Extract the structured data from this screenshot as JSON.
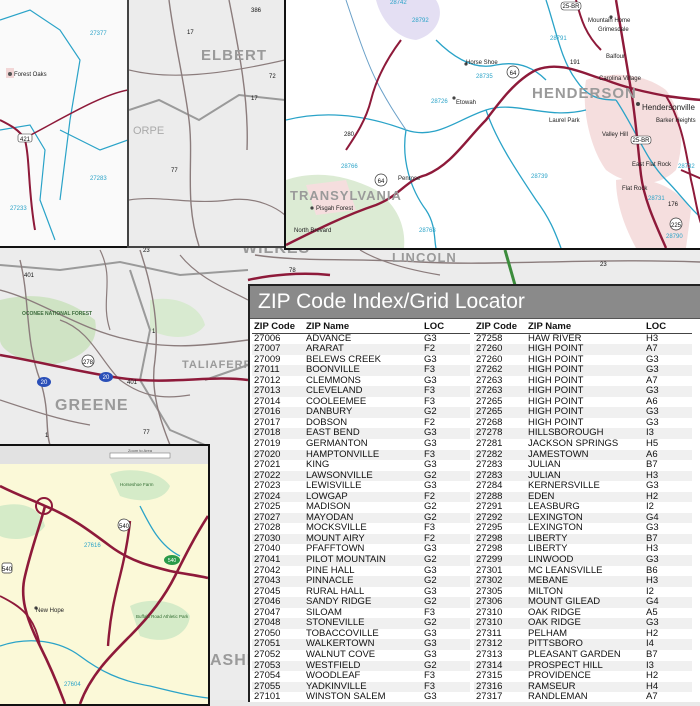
{
  "index": {
    "title": "ZIP Code Index/Grid Locator",
    "headers": [
      "ZIP Code",
      "ZIP Name",
      "LOC"
    ],
    "left_rows": [
      [
        "27006",
        "ADVANCE",
        "G3"
      ],
      [
        "27007",
        "ARARAT",
        "F2"
      ],
      [
        "27009",
        "BELEWS CREEK",
        "G3"
      ],
      [
        "27011",
        "BOONVILLE",
        "F3"
      ],
      [
        "27012",
        "CLEMMONS",
        "G3"
      ],
      [
        "27013",
        "CLEVELAND",
        "F3"
      ],
      [
        "27014",
        "COOLEEMEE",
        "F3"
      ],
      [
        "27016",
        "DANBURY",
        "G2"
      ],
      [
        "27017",
        "DOBSON",
        "F2"
      ],
      [
        "27018",
        "EAST BEND",
        "G3"
      ],
      [
        "27019",
        "GERMANTON",
        "G3"
      ],
      [
        "27020",
        "HAMPTONVILLE",
        "F3"
      ],
      [
        "27021",
        "KING",
        "G3"
      ],
      [
        "27022",
        "LAWSONVILLE",
        "G2"
      ],
      [
        "27023",
        "LEWISVILLE",
        "G3"
      ],
      [
        "27024",
        "LOWGAP",
        "F2"
      ],
      [
        "27025",
        "MADISON",
        "G2"
      ],
      [
        "27027",
        "MAYODAN",
        "G2"
      ],
      [
        "27028",
        "MOCKSVILLE",
        "F3"
      ],
      [
        "27030",
        "MOUNT AIRY",
        "F2"
      ],
      [
        "27040",
        "PFAFFTOWN",
        "G3"
      ],
      [
        "27041",
        "PILOT MOUNTAIN",
        "G2"
      ],
      [
        "27042",
        "PINE HALL",
        "G3"
      ],
      [
        "27043",
        "PINNACLE",
        "G2"
      ],
      [
        "27045",
        "RURAL HALL",
        "G3"
      ],
      [
        "27046",
        "SANDY RIDGE",
        "G2"
      ],
      [
        "27047",
        "SILOAM",
        "F3"
      ],
      [
        "27048",
        "STONEVILLE",
        "G2"
      ],
      [
        "27050",
        "TOBACCOVILLE",
        "G3"
      ],
      [
        "27051",
        "WALKERTOWN",
        "G3"
      ],
      [
        "27052",
        "WALNUT COVE",
        "G3"
      ],
      [
        "27053",
        "WESTFIELD",
        "G2"
      ],
      [
        "27054",
        "WOODLEAF",
        "F3"
      ],
      [
        "27055",
        "YADKINVILLE",
        "F3"
      ],
      [
        "27101",
        "WINSTON SALEM",
        "G3"
      ]
    ],
    "right_rows": [
      [
        "27258",
        "HAW RIVER",
        "H3"
      ],
      [
        "27260",
        "HIGH POINT",
        "A7"
      ],
      [
        "27260",
        "HIGH POINT",
        "G3"
      ],
      [
        "27262",
        "HIGH POINT",
        "G3"
      ],
      [
        "27263",
        "HIGH POINT",
        "A7"
      ],
      [
        "27263",
        "HIGH POINT",
        "G3"
      ],
      [
        "27265",
        "HIGH POINT",
        "A6"
      ],
      [
        "27265",
        "HIGH POINT",
        "G3"
      ],
      [
        "27268",
        "HIGH POINT",
        "G3"
      ],
      [
        "27278",
        "HILLSBOROUGH",
        "I3"
      ],
      [
        "27281",
        "JACKSON SPRINGS",
        "H5"
      ],
      [
        "27282",
        "JAMESTOWN",
        "A6"
      ],
      [
        "27283",
        "JULIAN",
        "B7"
      ],
      [
        "27283",
        "JULIAN",
        "H3"
      ],
      [
        "27284",
        "KERNERSVILLE",
        "G3"
      ],
      [
        "27288",
        "EDEN",
        "H2"
      ],
      [
        "27291",
        "LEASBURG",
        "I2"
      ],
      [
        "27292",
        "LEXINGTON",
        "G4"
      ],
      [
        "27295",
        "LEXINGTON",
        "G3"
      ],
      [
        "27298",
        "LIBERTY",
        "B7"
      ],
      [
        "27298",
        "LIBERTY",
        "H3"
      ],
      [
        "27299",
        "LINWOOD",
        "G3"
      ],
      [
        "27301",
        "MC LEANSVILLE",
        "B6"
      ],
      [
        "27302",
        "MEBANE",
        "H3"
      ],
      [
        "27305",
        "MILTON",
        "I2"
      ],
      [
        "27306",
        "MOUNT GILEAD",
        "G4"
      ],
      [
        "27310",
        "OAK RIDGE",
        "A5"
      ],
      [
        "27310",
        "OAK RIDGE",
        "G3"
      ],
      [
        "27311",
        "PELHAM",
        "H2"
      ],
      [
        "27312",
        "PITTSBORO",
        "I4"
      ],
      [
        "27313",
        "PLEASANT GARDEN",
        "B7"
      ],
      [
        "27314",
        "PROSPECT HILL",
        "I3"
      ],
      [
        "27315",
        "PROVIDENCE",
        "H2"
      ],
      [
        "27316",
        "RAMSEUR",
        "H4"
      ],
      [
        "27317",
        "RANDLEMAN",
        "A7"
      ]
    ]
  },
  "map": {
    "counties": [
      "ELBERT",
      "HENDERSON",
      "TRANSYLVANIA",
      "WILKES",
      "LINCOLN",
      "GREENE",
      "TALIAFERRO",
      "ASHE",
      "OCONEE NATIONAL FOREST"
    ],
    "places": [
      "Forest Oaks",
      "Mountain Home",
      "Grimesdale",
      "Balfour",
      "Barker Heights",
      "Horse Shoe",
      "Etowah",
      "Laurel Park",
      "Hendersonville",
      "Valley Hill",
      "Carolina Village",
      "East Flat Rock",
      "Flat Rock",
      "Pisgah Forest",
      "Penrose",
      "North Brevard",
      "New Hope",
      "Buffalo Road Athletic Park",
      "Horseshoe Farm"
    ],
    "zip_labels": [
      "27377",
      "27283",
      "27233",
      "28742",
      "28792",
      "28791",
      "28739",
      "28766",
      "28768",
      "28726",
      "28735",
      "28732",
      "28759",
      "28731",
      "28790",
      "27616",
      "27604",
      "27597"
    ],
    "routes": [
      "421",
      "386",
      "17",
      "77",
      "280",
      "64",
      "25-BR",
      "191",
      "176",
      "225",
      "22",
      "15",
      "44",
      "278",
      "20",
      "78",
      "23",
      "401",
      "1",
      "540"
    ],
    "inset_toolbar": "Zoom to Area",
    "colors": {
      "highway": "#8e1a3a",
      "zip_boundary": "#2aa3c8",
      "road": "#7a6a6a",
      "forest": "#cfe3c4",
      "urban": "#f2d6d6",
      "inset_bg": "#fbf9d8"
    }
  }
}
